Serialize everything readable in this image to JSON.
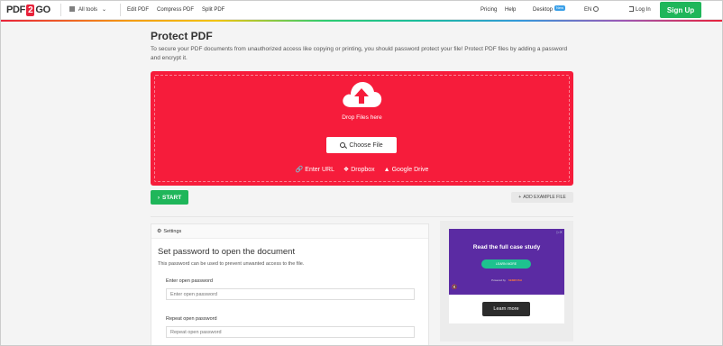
{
  "header": {
    "logo": {
      "pdf": "PDF",
      "two": "2",
      "go": "GO"
    },
    "all_tools": "All tools",
    "links": [
      "Edit PDF",
      "Compress PDF",
      "Split PDF"
    ],
    "pricing": "Pricing",
    "help": "Help",
    "desktop": "Desktop",
    "desktop_badge": "New",
    "language": "EN",
    "login": "Log In",
    "signup": "Sign Up"
  },
  "main": {
    "title": "Protect PDF",
    "description": "To secure your PDF documents from unauthorized access like copying or printing, you should password protect your file! Protect PDF files by adding a password and encrypt it.",
    "dropzone": {
      "drop_text": "Drop Files here",
      "choose_file": "Choose File",
      "enter_url": "Enter URL",
      "dropbox": "Dropbox",
      "google_drive": "Google Drive"
    },
    "start": "START",
    "add_example": "ADD EXAMPLE FILE"
  },
  "settings": {
    "header": "Settings",
    "title": "Set password to open the document",
    "subtitle": "This password can be used to prevent unwanted access to the file.",
    "open_password_label": "Enter open password",
    "open_password_placeholder": "Enter open password",
    "repeat_password_label": "Repeat open password",
    "repeat_password_placeholder": "Repeat open password"
  },
  "ad": {
    "title": "Read the full case study",
    "learn_more": "LEARN MORE",
    "powered_by": "Powered by",
    "brand": "SEMRUSH",
    "button": "Learn more"
  },
  "colors": {
    "brand_red": "#f61c3b",
    "green": "#1fb65a",
    "ad_purple": "#5b2ba3"
  }
}
